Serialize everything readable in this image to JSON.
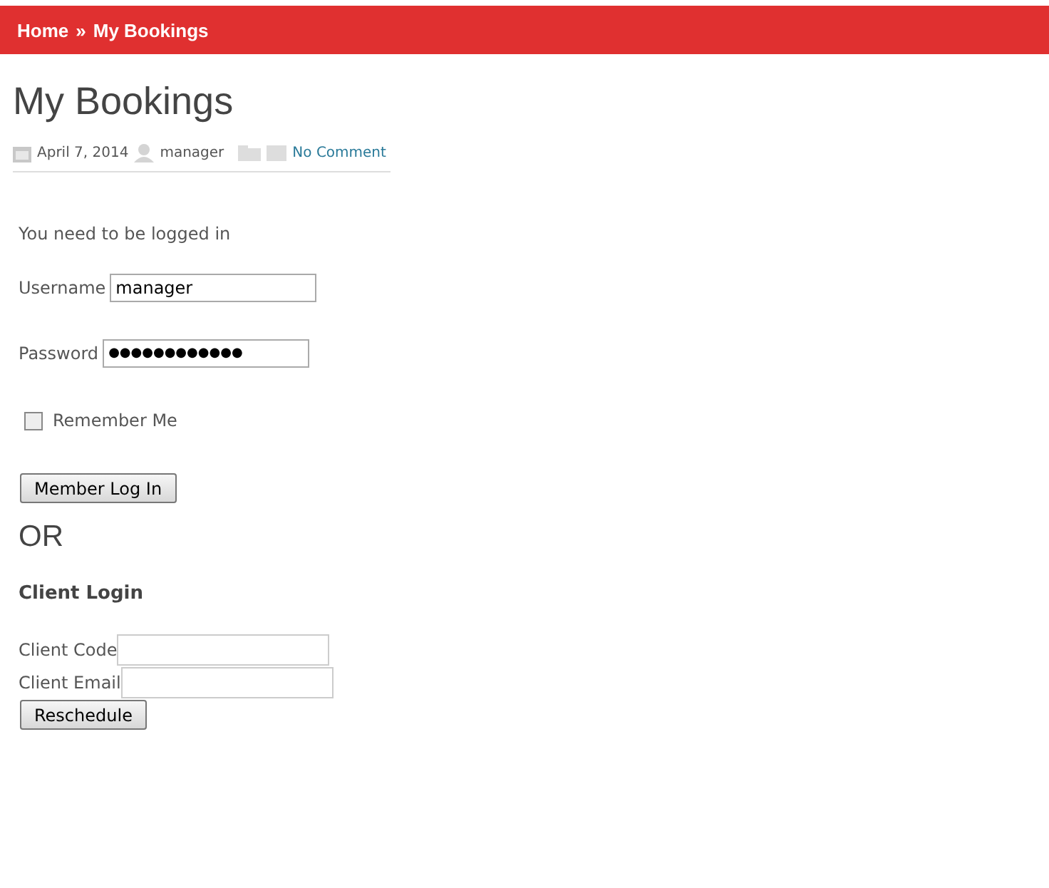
{
  "breadcrumb": {
    "home": "Home",
    "separator": "»",
    "current": "My Bookings"
  },
  "title": "My Bookings",
  "meta": {
    "date": "April 7, 2014",
    "author": "manager",
    "comments": "No Comment"
  },
  "notice": "You need to be logged in",
  "member_login": {
    "username_label": "Username",
    "username_value": "manager",
    "password_label": "Password",
    "password_value": "●●●●●●●●●●●●",
    "remember_label": "Remember Me",
    "remember_checked": false,
    "button": "Member Log In"
  },
  "or_text": "OR",
  "client_login": {
    "heading": "Client Login",
    "code_label": "Client Code",
    "email_label": "Client Email",
    "button": "Reschedule"
  }
}
